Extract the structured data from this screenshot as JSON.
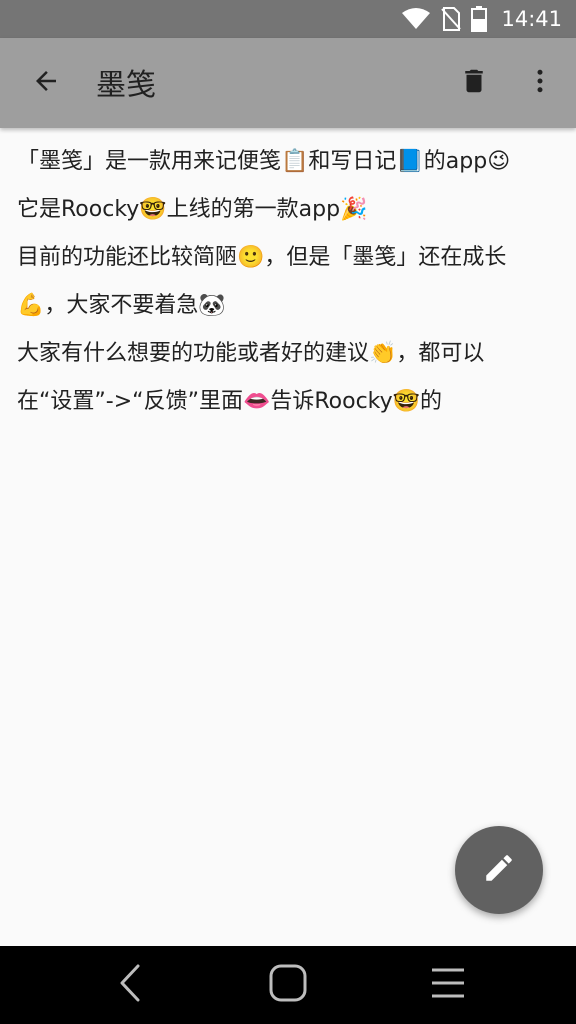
{
  "status_bar": {
    "time": "14:41",
    "icons": [
      "wifi-icon",
      "no-sim-icon",
      "battery-icon"
    ]
  },
  "app_bar": {
    "title": "墨笺",
    "back_icon": "arrow-left-icon",
    "delete_icon": "trash-icon",
    "more_icon": "more-vertical-icon"
  },
  "note": {
    "lines": [
      "「墨笺」是一款用来记便笺📋和写日记📘的app😉",
      "它是Roocky🤓上线的第一款app🎉",
      "目前的功能还比较简陋🙂，但是「墨笺」还在成长",
      "💪，大家不要着急🐼",
      "大家有什么想要的功能或者好的建议👏，都可以",
      "在“设置”->“反馈”里面👄告诉Roocky🤓的"
    ]
  },
  "fab": {
    "icon": "pencil-icon"
  },
  "nav_bar": {
    "icons": [
      "nav-back-icon",
      "nav-home-icon",
      "nav-menu-icon"
    ]
  },
  "colors": {
    "status_bar": "#757575",
    "app_bar": "#9e9e9e",
    "background": "#fafafa",
    "fab": "#616161",
    "nav_bar": "#000000"
  }
}
